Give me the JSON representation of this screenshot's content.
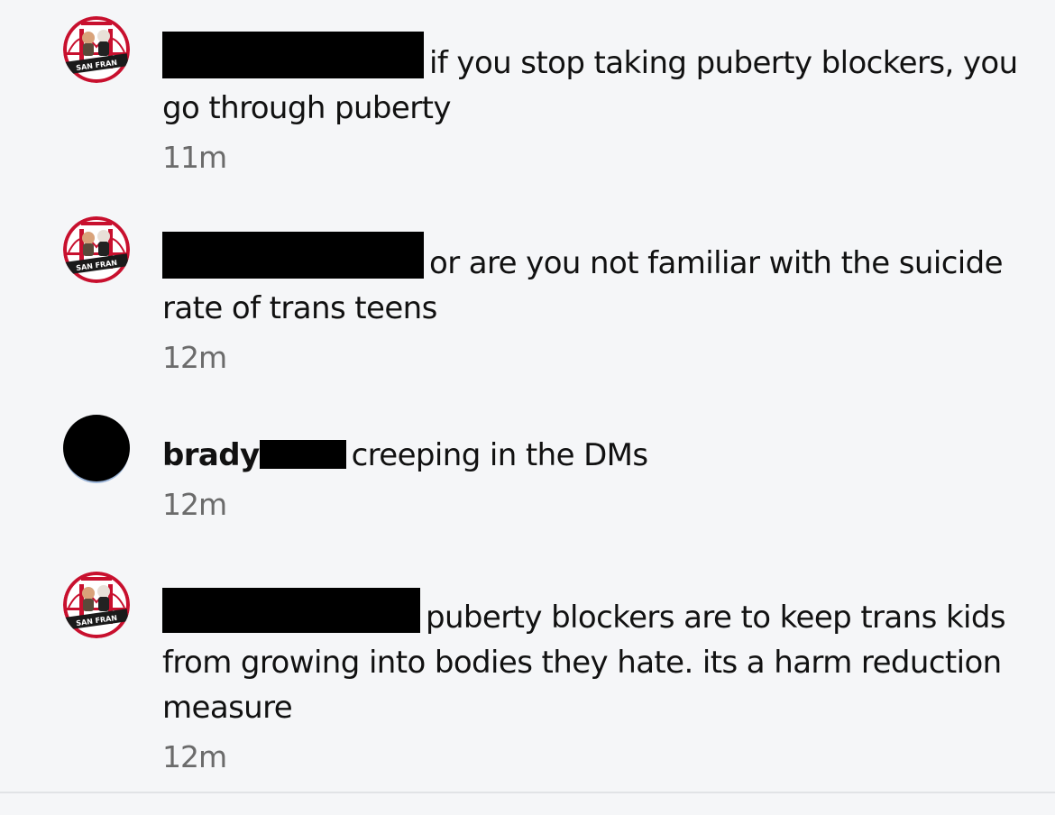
{
  "comments": [
    {
      "text": "if you stop taking puberty blockers, you go through puberty",
      "time": "11m",
      "avatar_text": "SAN FRAN"
    },
    {
      "text": "or are you not familiar with the suicide rate of trans teens",
      "time": "12m",
      "avatar_text": "SAN FRAN"
    },
    {
      "username": "brady",
      "text": "creeping in the DMs",
      "time": "12m"
    },
    {
      "text": "puberty blockers are to keep trans kids from growing into bodies they hate.  its a harm reduction measure",
      "time": "12m",
      "avatar_text": "SAN FRAN"
    }
  ],
  "colors": {
    "background": "#f5f6f8",
    "text": "#111111",
    "timestamp": "#6b6b6b",
    "avatar_ring": "#c8102e"
  },
  "icons": {
    "redaction": "black-bar",
    "avatar_logo": "bridge-logo-icon"
  }
}
